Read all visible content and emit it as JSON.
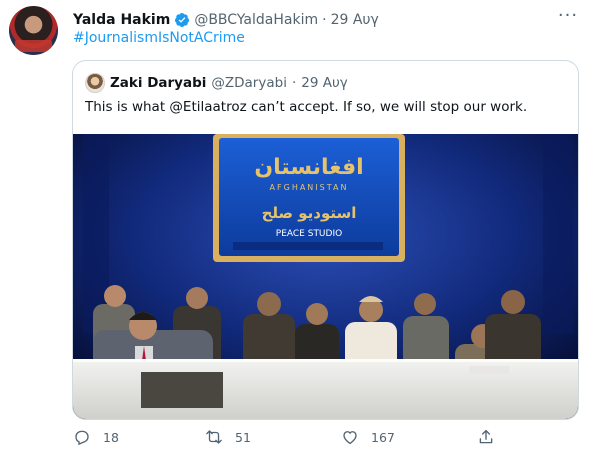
{
  "tweet": {
    "author_name": "Yalda Hakim",
    "author_handle": "@BBCYaldaHakim",
    "separator": "·",
    "date": "29 Αυγ",
    "more_label": "···",
    "hashtag": "#JournalismIsNotACrime"
  },
  "quoted_tweet": {
    "author_name": "Zaki Daryabi",
    "author_handle": "@ZDaryabi",
    "separator": "·",
    "date": "29 Αυγ",
    "text": "This is what @Etilaatroz can’t accept. If so, we will stop our work.",
    "media": {
      "screen_title": "افغانستان",
      "screen_subtitle": "AFGHANISTAN",
      "screen_line": "استودیو صلح",
      "screen_label": "PEACE STUDIO"
    }
  },
  "actions": {
    "replies": "18",
    "retweets": "51",
    "likes": "167"
  },
  "colors": {
    "link": "#1d9bf0",
    "muted": "#536471",
    "verified": "#1d9bf0"
  },
  "icons": [
    "verified-badge-icon",
    "more-icon",
    "reply-icon",
    "retweet-icon",
    "like-icon",
    "share-icon"
  ]
}
